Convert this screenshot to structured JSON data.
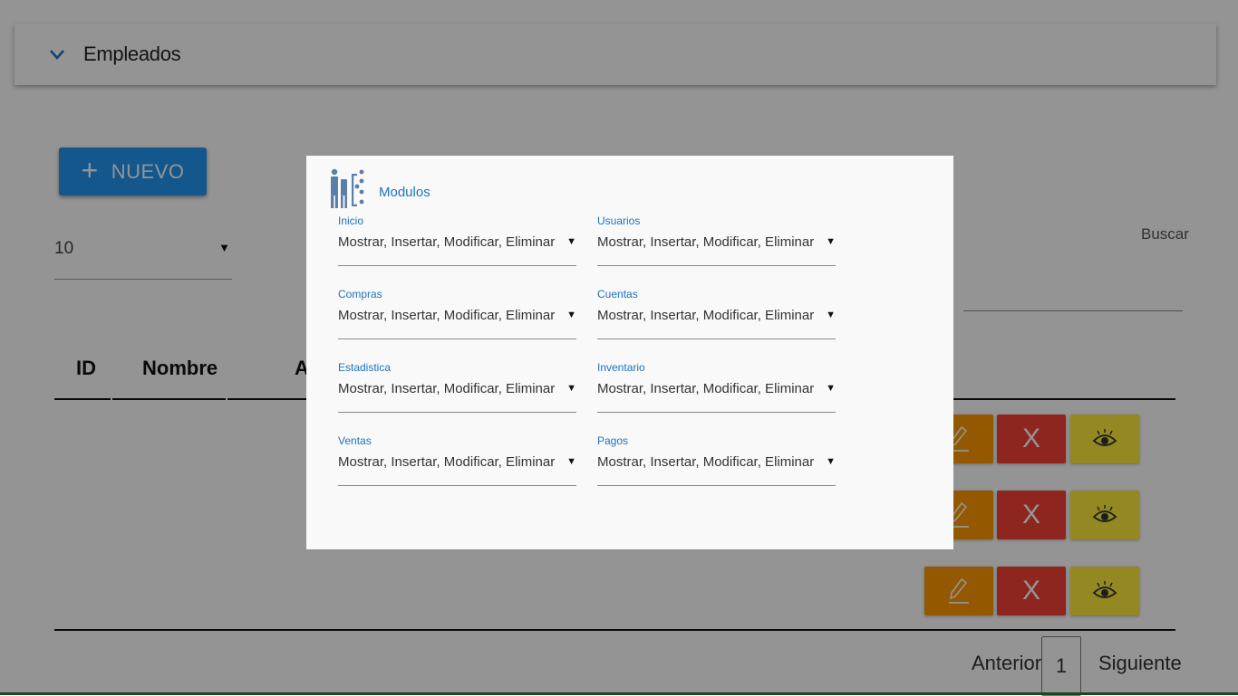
{
  "header": {
    "title": "Empleados",
    "toggle_icon": "chevron-down-icon"
  },
  "toolbar": {
    "new_label": "NUEVO",
    "new_icon": "plus-icon"
  },
  "page_size": {
    "value": "10"
  },
  "search": {
    "label": "Buscar",
    "value": ""
  },
  "table": {
    "columns": [
      "ID",
      "Nombre",
      "A"
    ],
    "rows": [
      {
        "actions": [
          "edit",
          "delete",
          "view"
        ],
        "delete_label": "X"
      },
      {
        "actions": [
          "edit",
          "delete",
          "view"
        ],
        "delete_label": "X"
      },
      {
        "actions": [
          "edit",
          "delete",
          "view"
        ],
        "delete_label": "X"
      }
    ]
  },
  "pagination": {
    "prev_label": "Anterior",
    "current_page": "1",
    "next_label": "Siguiente"
  },
  "modal": {
    "title": "Modulos",
    "icon": "users-permissions-icon",
    "fields": [
      {
        "label": "Inicio",
        "value": "Mostrar, Insertar, Modificar, Eliminar"
      },
      {
        "label": "Usuarios",
        "value": "Mostrar, Insertar, Modificar, Eliminar"
      },
      {
        "label": "Compras",
        "value": "Mostrar, Insertar, Modificar, Eliminar"
      },
      {
        "label": "Cuentas",
        "value": "Mostrar, Insertar, Modificar, Eliminar"
      },
      {
        "label": "Estadistica",
        "value": "Mostrar, Insertar, Modificar, Eliminar"
      },
      {
        "label": "Inventario",
        "value": "Mostrar, Insertar, Modificar, Eliminar"
      },
      {
        "label": "Ventas",
        "value": "Mostrar, Insertar, Modificar, Eliminar"
      },
      {
        "label": "Pagos",
        "value": "Mostrar, Insertar, Modificar, Eliminar"
      }
    ]
  },
  "colors": {
    "primary": "#2196f3",
    "edit": "#ff9800",
    "delete": "#f44336",
    "view": "#ffeb3b",
    "modal_label": "#1e73be"
  }
}
